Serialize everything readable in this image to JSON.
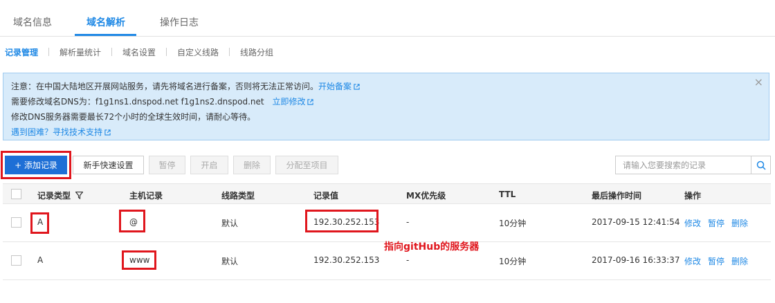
{
  "tabs": [
    {
      "label": "域名信息"
    },
    {
      "label": "域名解析"
    },
    {
      "label": "操作日志"
    }
  ],
  "subnav": [
    {
      "label": "记录管理"
    },
    {
      "label": "解析量统计"
    },
    {
      "label": "域名设置"
    },
    {
      "label": "自定义线路"
    },
    {
      "label": "线路分组"
    }
  ],
  "notice": {
    "line1_text": "注意：在中国大陆地区开展网站服务，请先将域名进行备案，否则将无法正常访问。",
    "line1_link": "开始备案",
    "line2_text": "需要修改域名DNS为：f1g1ns1.dnspod.net f1g1ns2.dnspod.net",
    "line2_link": "立即修改",
    "line3_text": "修改DNS服务器需要最长72个小时的全球生效时间，请耐心等待。",
    "line4_link": "遇到困难？寻找技术支持",
    "close_icon": "close-icon"
  },
  "toolbar": {
    "add_label": "+ 添加记录",
    "quick_setup_label": "新手快速设置",
    "pause_label": "暂停",
    "enable_label": "开启",
    "delete_label": "删除",
    "assign_label": "分配至项目",
    "search_placeholder": "请输入您要搜索的记录",
    "search_icon": "search-icon"
  },
  "table": {
    "headers": [
      "记录类型",
      "主机记录",
      "线路类型",
      "记录值",
      "MX优先级",
      "TTL",
      "最后操作时间",
      "操作"
    ],
    "rows": [
      {
        "type": "A",
        "host": "@",
        "line": "默认",
        "value": "192.30.252.153",
        "mx": "-",
        "ttl": "10分钟",
        "time": "2017-09-15 12:41:54",
        "ops": [
          "修改",
          "暂停",
          "删除"
        ]
      },
      {
        "type": "A",
        "host": "www",
        "line": "默认",
        "value": "192.30.252.153",
        "mx": "-",
        "ttl": "10分钟",
        "time": "2017-09-16 16:33:37",
        "ops": [
          "修改",
          "暂停",
          "删除"
        ]
      }
    ]
  },
  "annotation": "指向gitHub的服务器",
  "colors": {
    "accent": "#1e88e5",
    "primary_button": "#1e6fd6",
    "highlight_red": "#e0161d",
    "notice_bg": "#d8ebfa"
  }
}
